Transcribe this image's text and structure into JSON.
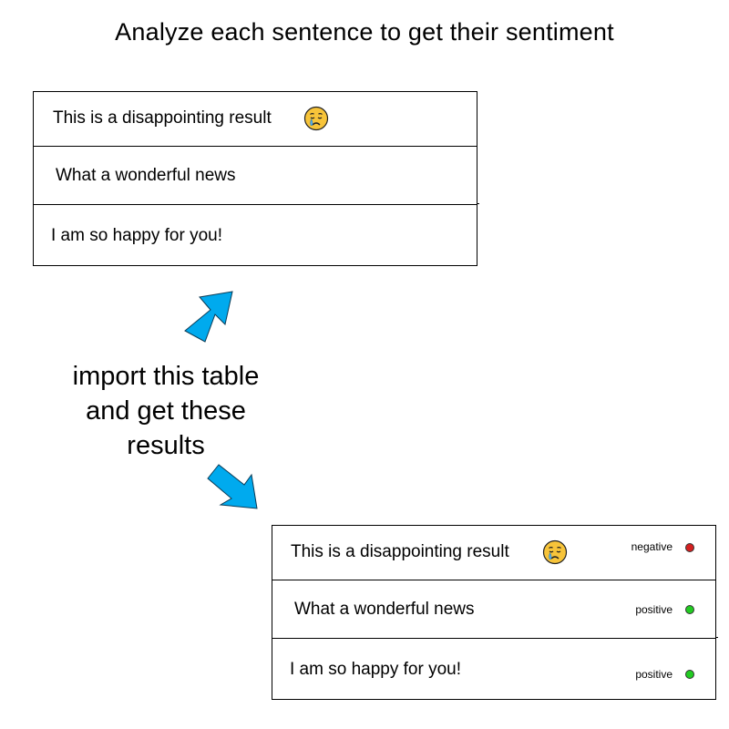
{
  "header": {
    "title": "Analyze each sentence to get their sentiment"
  },
  "input_table": {
    "rows": [
      {
        "text": "This is a disappointing result",
        "emoji": "disappointed-crying-face-icon"
      },
      {
        "text": "What a wonderful news"
      },
      {
        "text": "I am so happy for you!"
      }
    ]
  },
  "instruction": {
    "line1": "import this table",
    "line2": "and get these",
    "line3": "results"
  },
  "output_table": {
    "rows": [
      {
        "text": "This is a disappointing result",
        "emoji": "disappointed-crying-face-icon",
        "sentiment": "negative",
        "color": "#d42020"
      },
      {
        "text": "What a wonderful news",
        "sentiment": "positive",
        "color": "#22cc22"
      },
      {
        "text": "I am so happy for you!",
        "sentiment": "positive",
        "color": "#22cc22"
      }
    ]
  },
  "colors": {
    "arrow_fill": "#00aaee",
    "negative": "#d42020",
    "positive": "#22cc22"
  }
}
